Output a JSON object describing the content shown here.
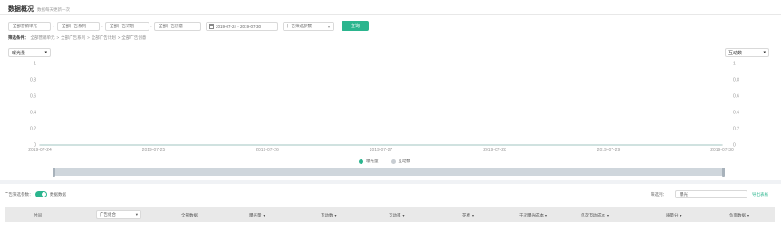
{
  "header": {
    "title": "数据概况",
    "subtitle": "数据每天更新一次"
  },
  "filters": {
    "account": "全部营销单元",
    "series": "全部广告系列",
    "plan": "全部广告计划",
    "creative": "全部广告创意",
    "date_range": "2019-07-24 - 2019-07-30",
    "dimension": "广告筛选参数",
    "query_label": "查询"
  },
  "filter_path": {
    "label": "筛选条件：",
    "items": [
      "全部营销单元",
      "全部广告系列",
      "全部广告计划",
      "全部广告创意"
    ]
  },
  "chart_controls": {
    "left_metric": "曝光量",
    "right_metric": "互动数"
  },
  "chart_data": {
    "type": "line",
    "x": [
      "2019-07-24",
      "2019-07-25",
      "2019-07-26",
      "2019-07-27",
      "2019-07-28",
      "2019-07-29",
      "2019-07-30"
    ],
    "series": [
      {
        "name": "曝光量",
        "values": [
          0,
          0,
          0,
          0,
          0,
          0,
          0
        ],
        "color": "#2bb58e"
      },
      {
        "name": "互动数",
        "values": [
          0,
          0,
          0,
          0,
          0,
          0,
          0
        ],
        "color": "#c8cdd2"
      }
    ],
    "y_ticks": [
      "0",
      "0.2",
      "0.4",
      "0.6",
      "0.8",
      "1"
    ],
    "ylim": [
      0,
      1
    ],
    "grid": false,
    "legend_position": "bottom"
  },
  "table_controls": {
    "dimension_label": "广告筛选参数：",
    "toggle_label": "数据数据",
    "filter_label": "筛选列：",
    "filter_value": "曝光",
    "export_label": "导出表格"
  },
  "table": {
    "headers": [
      "时间",
      "广告组合",
      "全部数据",
      "曝光量",
      "互动数",
      "互动率",
      "花费",
      "千次曝光成本",
      "单次互动成本",
      "质量分",
      "负面数据"
    ],
    "sortable": [
      false,
      false,
      false,
      true,
      true,
      true,
      true,
      true,
      true,
      true,
      true
    ]
  }
}
